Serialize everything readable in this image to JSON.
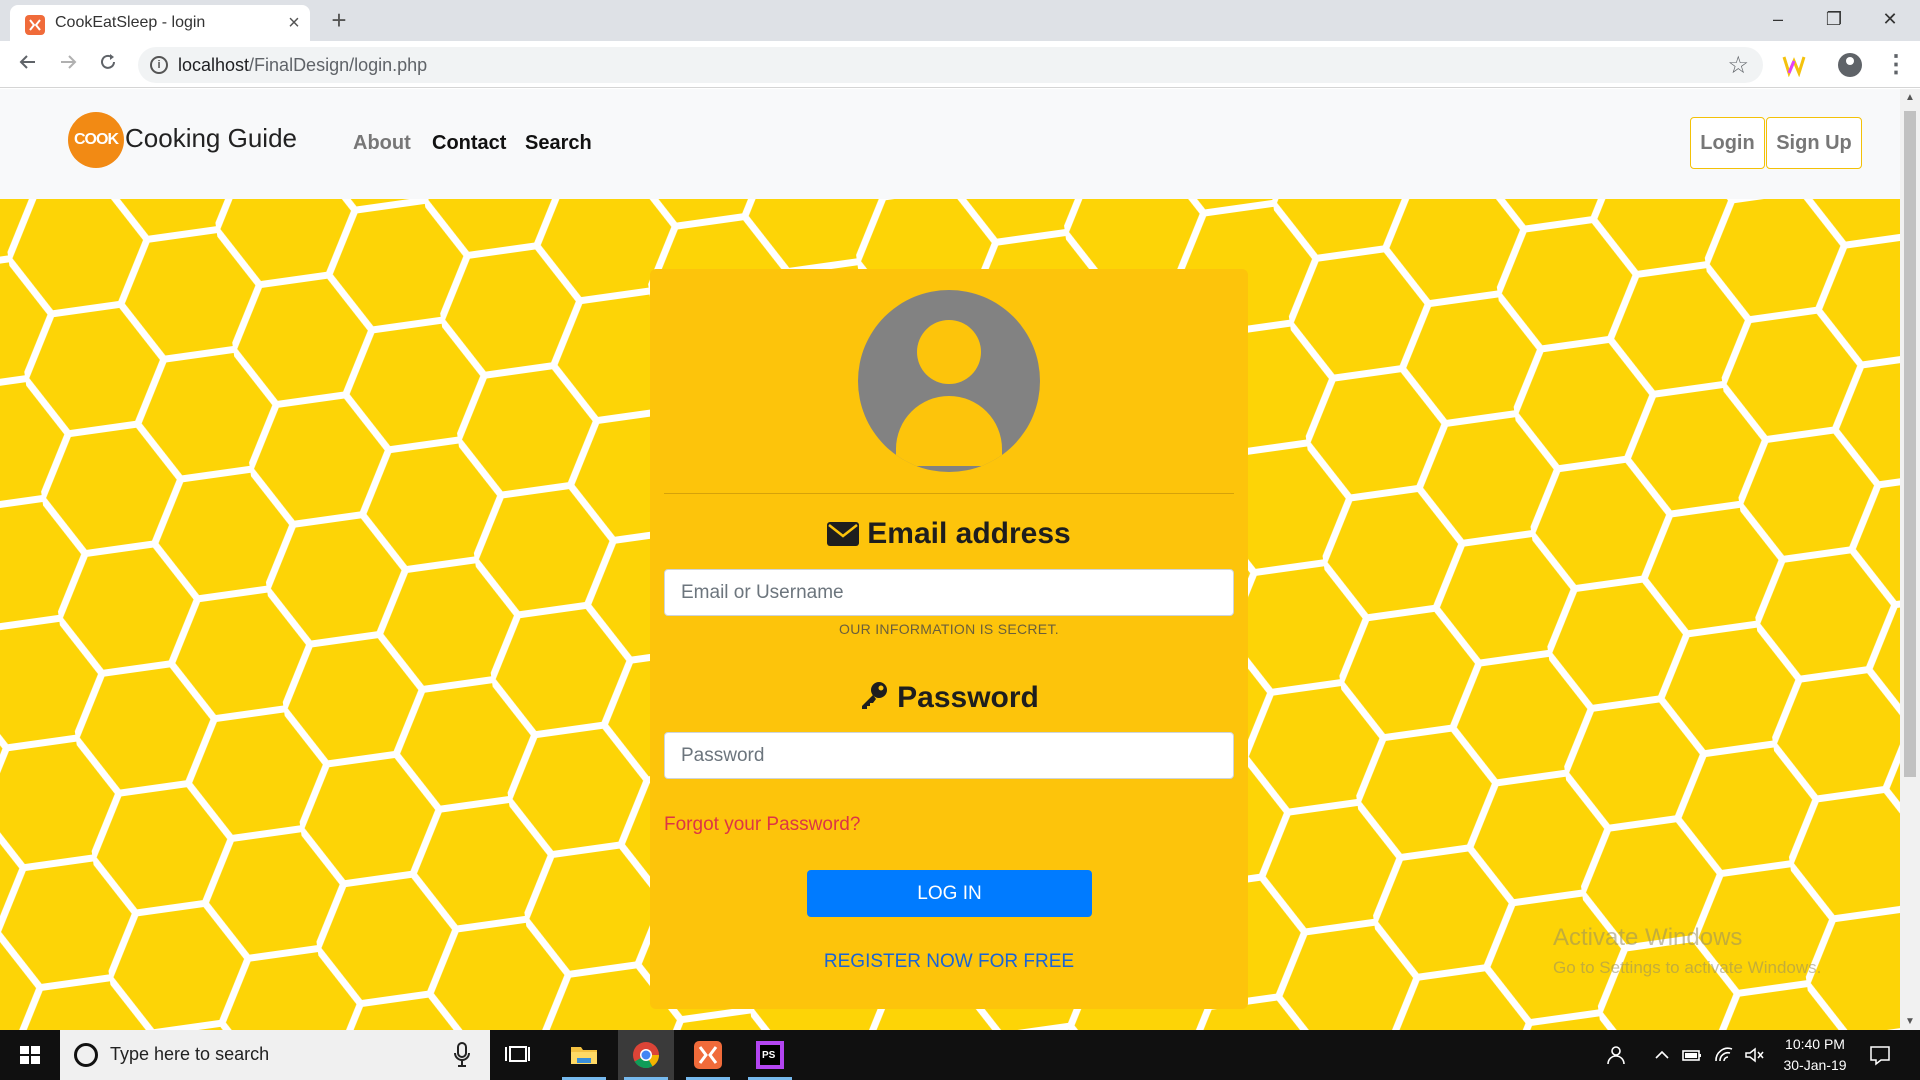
{
  "browser": {
    "tab_title": "CookEatSleep - login",
    "tab_close": "×",
    "new_tab": "+",
    "url_host": "localhost",
    "url_path": "/FinalDesign/login.php",
    "window_minimize": "–",
    "window_restore": "❐",
    "window_close": "✕",
    "icons": [
      "back-arrow-icon",
      "forward-arrow-icon",
      "reload-icon",
      "info-icon",
      "star-icon",
      "extension-icon",
      "profile-icon",
      "menu-icon"
    ]
  },
  "site_nav": {
    "brand_logo_text": "COOK",
    "brand_name": "Cooking Guide",
    "links": [
      "About",
      "Contact",
      "Search"
    ],
    "login_label": "Login",
    "signup_label": "Sign Up"
  },
  "login_form": {
    "email_heading": "Email address",
    "email_placeholder": "Email or Username",
    "email_hint": "OUR INFORMATION IS SECRET.",
    "password_heading": "Password",
    "password_placeholder": "Password",
    "forgot_link": "Forgot your Password?",
    "login_button": "LOG IN",
    "register_link": "REGISTER NOW FOR FREE"
  },
  "watermark": {
    "title": "Activate Windows",
    "subtitle": "Go to Settings to activate Windows."
  },
  "taskbar": {
    "search_placeholder": "Type here to search",
    "apps": [
      "file-explorer",
      "chrome",
      "xampp",
      "phpstorm"
    ],
    "time": "10:40 PM",
    "date": "30-Jan-19"
  },
  "colors": {
    "honeycomb_bg": "#fdd406",
    "card_bg": "#fdc40b",
    "primary_button": "#007bff",
    "forgot_link": "#dc3545",
    "nav_button_border": "#f3c107"
  }
}
